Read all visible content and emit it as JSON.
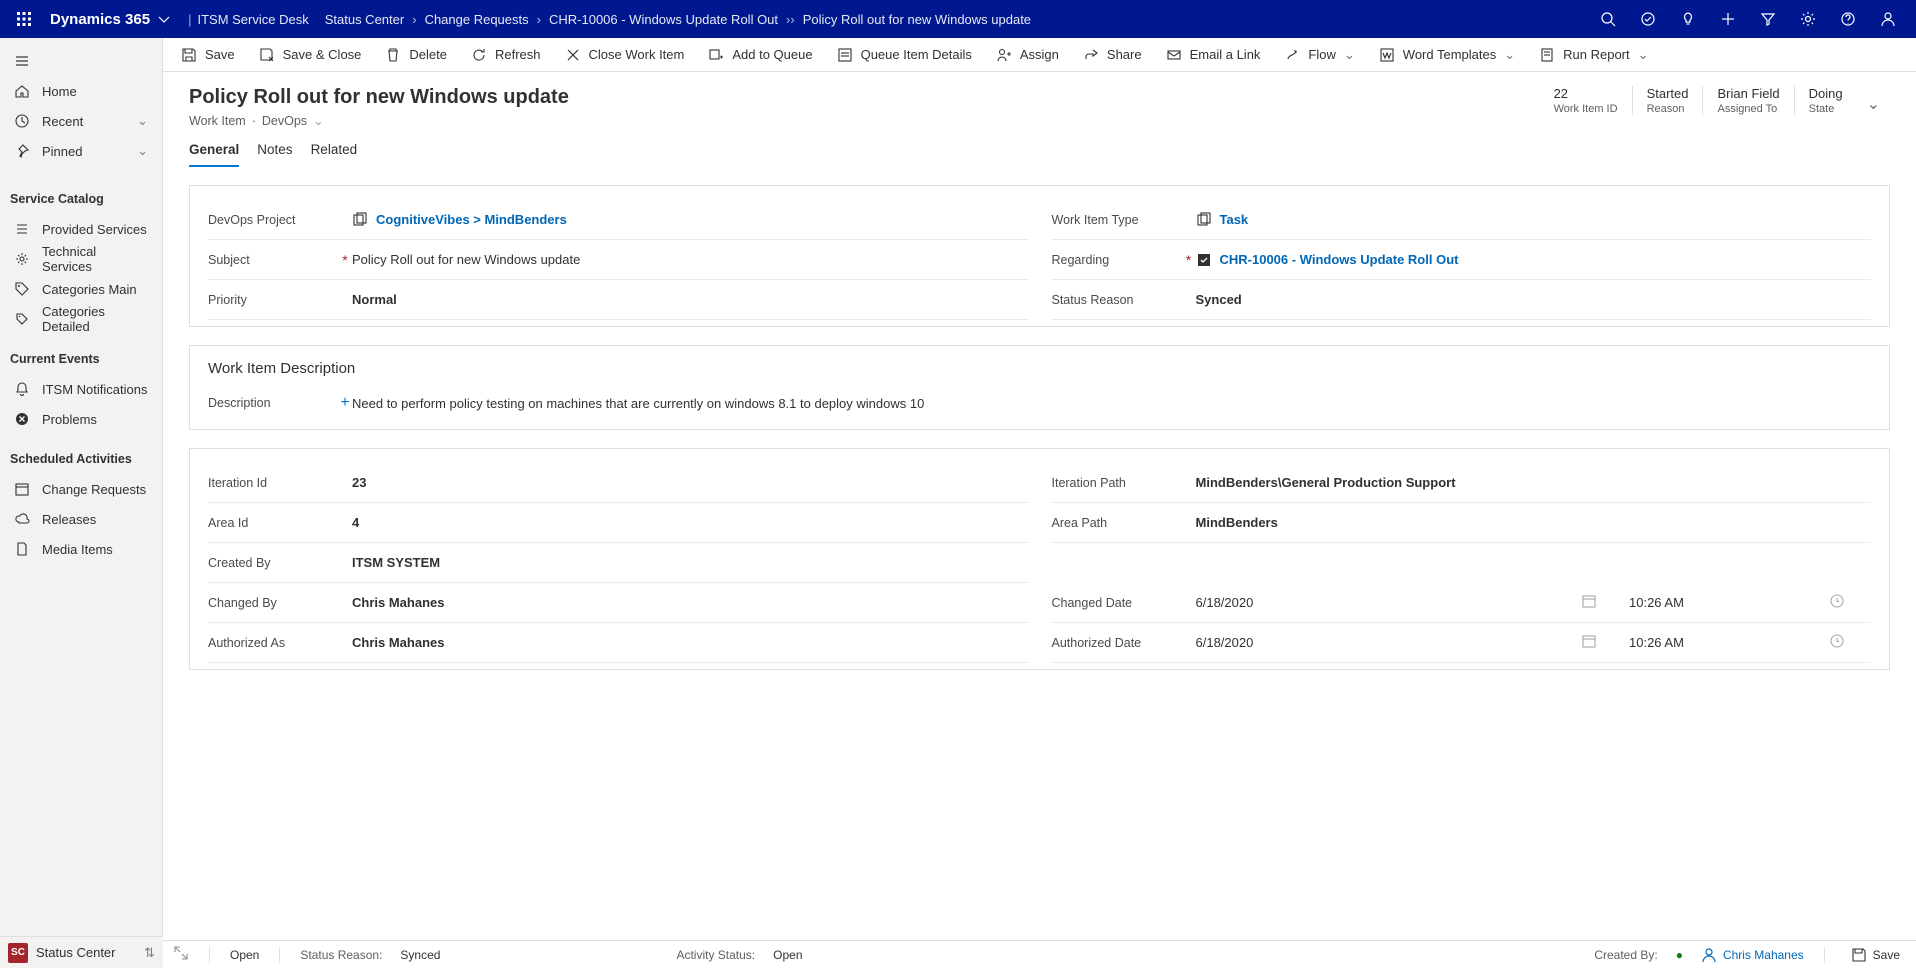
{
  "app": "Dynamics 365",
  "topbar": {
    "area": "ITSM Service Desk",
    "breadcrumbs": [
      "Status Center",
      "Change Requests",
      "CHR-10006 - Windows Update Roll Out",
      "Policy Roll out for new Windows update"
    ]
  },
  "commandbar": {
    "save": "Save",
    "saveclose": "Save & Close",
    "delete": "Delete",
    "refresh": "Refresh",
    "closework": "Close Work Item",
    "addqueue": "Add to Queue",
    "queuedetails": "Queue Item Details",
    "assign": "Assign",
    "share": "Share",
    "emaillink": "Email a Link",
    "flow": "Flow",
    "wordtemplates": "Word Templates",
    "runreport": "Run Report"
  },
  "sidebar": {
    "home": "Home",
    "recent": "Recent",
    "pinned": "Pinned",
    "groups": [
      {
        "title": "Service Catalog",
        "items": [
          "Provided Services",
          "Technical Services",
          "Categories Main",
          "Categories Detailed"
        ]
      },
      {
        "title": "Current Events",
        "items": [
          "ITSM Notifications",
          "Problems"
        ]
      },
      {
        "title": "Scheduled Activities",
        "items": [
          "Change Requests",
          "Releases",
          "Media Items"
        ]
      }
    ],
    "app_badge": "SC",
    "app_name": "Status Center"
  },
  "form": {
    "title": "Policy Roll out for new Windows update",
    "sub_entity": "Work Item",
    "sub_dot": "·",
    "sub_formname": "DevOps",
    "header_stats": [
      {
        "value": "22",
        "label": "Work Item ID"
      },
      {
        "value": "Started",
        "label": "Reason"
      },
      {
        "value": "Brian Field",
        "label": "Assigned To"
      },
      {
        "value": "Doing",
        "label": "State"
      }
    ],
    "tabs": [
      "General",
      "Notes",
      "Related"
    ],
    "section1": {
      "devops_project": {
        "label": "DevOps Project",
        "value": "CognitiveVibes > MindBenders"
      },
      "subject": {
        "label": "Subject",
        "value": "Policy Roll out for new Windows update"
      },
      "priority": {
        "label": "Priority",
        "value": "Normal"
      },
      "work_item_type": {
        "label": "Work Item Type",
        "value": "Task"
      },
      "regarding": {
        "label": "Regarding",
        "value": "CHR-10006 - Windows Update Roll Out"
      },
      "status_reason": {
        "label": "Status Reason",
        "value": "Synced"
      }
    },
    "section2": {
      "title": "Work Item Description",
      "description": {
        "label": "Description",
        "value": "Need to perform policy testing on machines that are currently on windows 8.1 to deploy windows 10"
      }
    },
    "section3": {
      "iteration_id": {
        "label": "Iteration Id",
        "value": "23"
      },
      "area_id": {
        "label": "Area Id",
        "value": "4"
      },
      "created_by": {
        "label": "Created By",
        "value": "ITSM SYSTEM"
      },
      "changed_by": {
        "label": "Changed By",
        "value": "Chris Mahanes"
      },
      "authorized_as": {
        "label": "Authorized As",
        "value": "Chris Mahanes"
      },
      "iteration_path": {
        "label": "Iteration Path",
        "value": "MindBenders\\General Production Support"
      },
      "area_path": {
        "label": "Area Path",
        "value": "MindBenders"
      },
      "changed_date": {
        "label": "Changed Date",
        "date": "6/18/2020",
        "time": "10:26 AM"
      },
      "authorized_date": {
        "label": "Authorized Date",
        "date": "6/18/2020",
        "time": "10:26 AM"
      }
    }
  },
  "status": {
    "state": "Open",
    "status_reason_label": "Status Reason:",
    "status_reason_value": "Synced",
    "activity_status_label": "Activity Status:",
    "activity_status_value": "Open",
    "created_by_label": "Created By:",
    "created_by_value": "Chris Mahanes",
    "save": "Save"
  }
}
